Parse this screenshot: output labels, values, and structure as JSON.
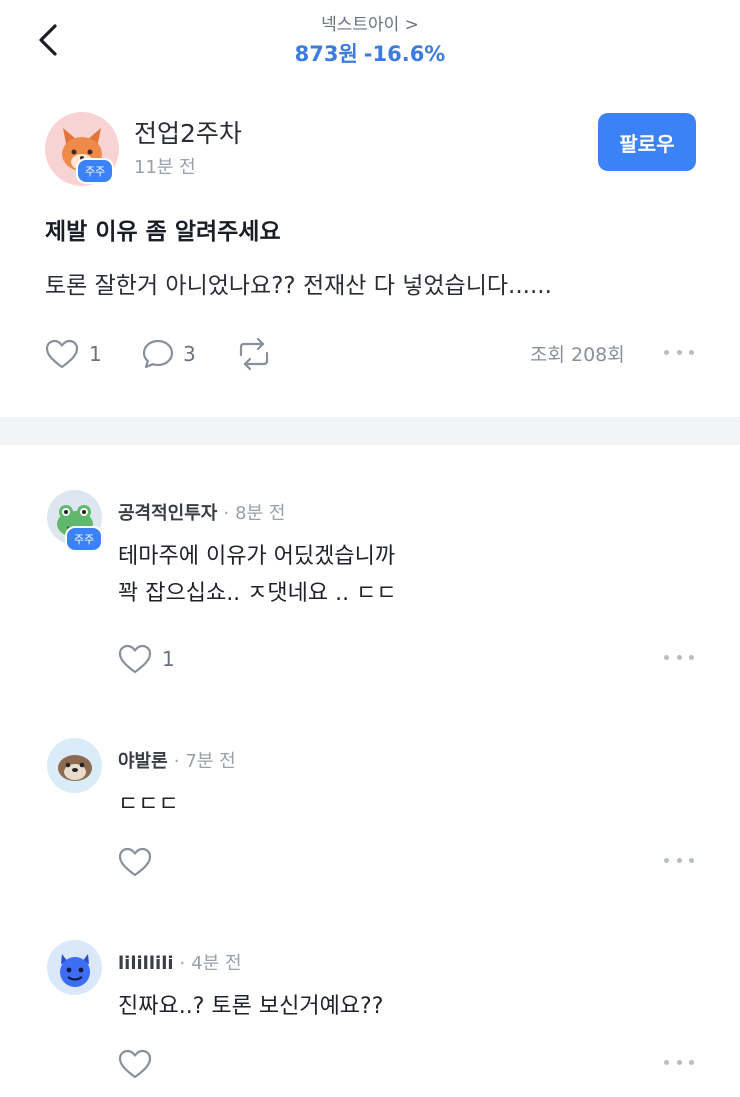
{
  "header": {
    "stock_name": "넥스트아이 >",
    "price": "873원",
    "change": "-16.6%"
  },
  "post": {
    "author": "전업2주차",
    "badge": "주주",
    "time": "11분 전",
    "follow_label": "팔로우",
    "title": "제발 이유 좀 알려주세요",
    "body": "토론 잘한거 아니었나요?? 전재산 다 넣었습니다......",
    "likes": "1",
    "comments": "3",
    "views": "조회 208회"
  },
  "comments": [
    {
      "author": "공격적인투자",
      "badge": "주주",
      "dot": "·",
      "time": "8분 전",
      "line1": "테마주에 이유가 어딨겠습니까",
      "line2": "꽉 잡으십쇼.. ㅈ댓네요 .. ㄷㄷ",
      "likes": "1"
    },
    {
      "author": "야발론",
      "dot": "·",
      "time": "7분 전",
      "line1": "ㄷㄷㄷ"
    },
    {
      "author": "lilillili",
      "dot": "·",
      "time": "4분 전",
      "line1": "진짜요..? 토론 보신거예요??"
    }
  ]
}
